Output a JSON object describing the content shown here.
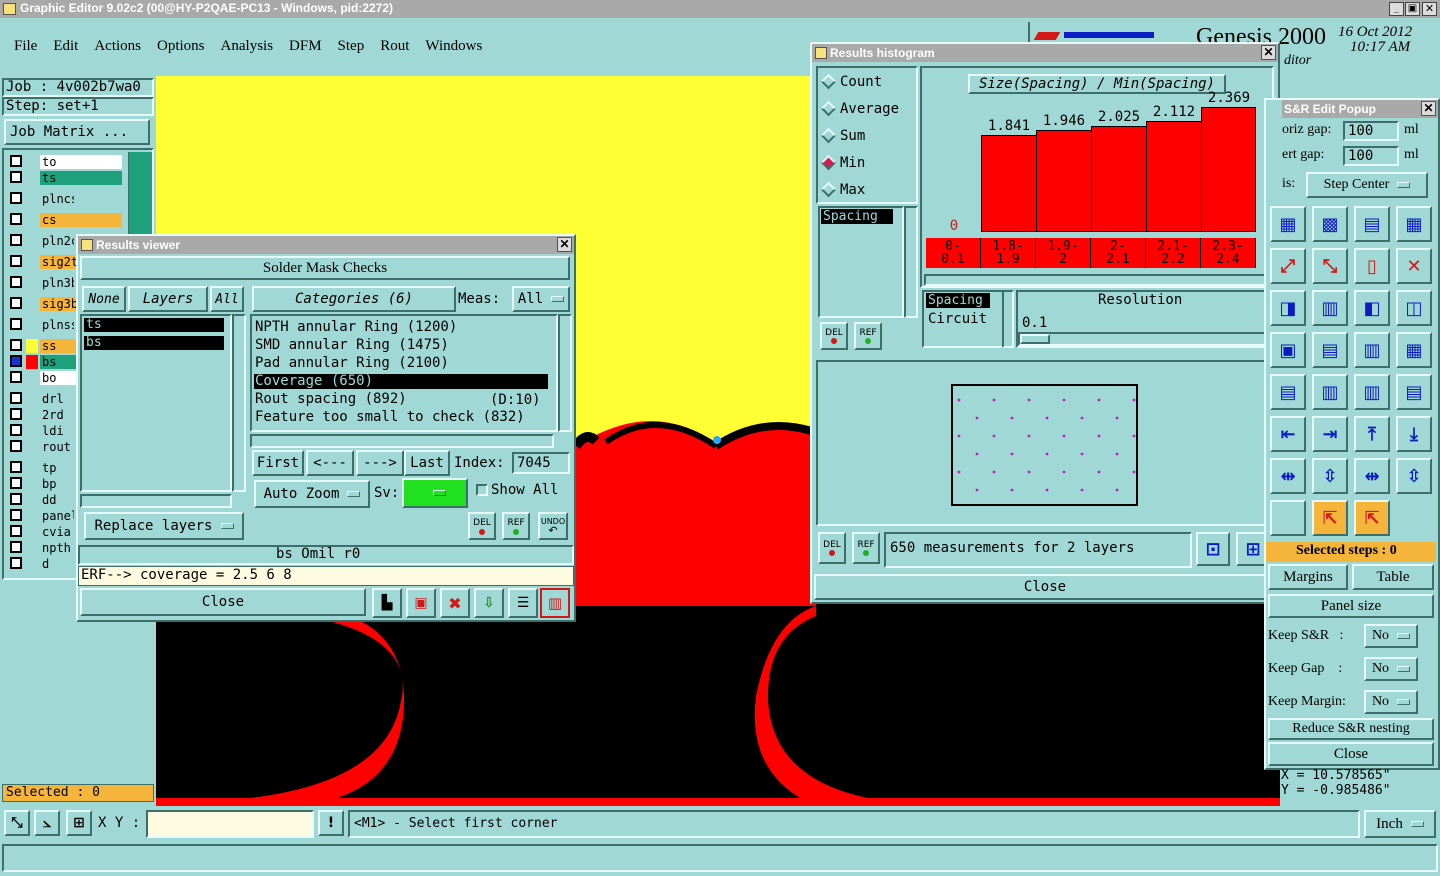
{
  "window_title": "Graphic Editor 9.02c2 (00@HY-P2QAE-PC13 - Windows, pid:2272)",
  "menu": [
    "File",
    "Edit",
    "Actions",
    "Options",
    "Analysis",
    "DFM",
    "Step",
    "Rout",
    "Windows"
  ],
  "app": {
    "product": "Genesis 2000",
    "date": "16 Oct 2012",
    "time": "10:17 AM",
    "sub": "ditor"
  },
  "left": {
    "job": "Job : 4v002b7wa0",
    "step": "Step: set+1",
    "job_matrix": "Job Matrix ...",
    "selected": "Selected : 0",
    "layers": [
      {
        "name": "to",
        "bg": "#ffffff"
      },
      {
        "name": "ts",
        "bg": "#1fa07c"
      },
      {
        "name": "plncs",
        "bg": "#9fd8d4"
      },
      {
        "name": "cs",
        "bg": "#f5b53b"
      },
      {
        "name": "pln2c",
        "bg": "#9fd8d4"
      },
      {
        "name": "sig2t",
        "bg": "#f5b53b"
      },
      {
        "name": "pln3b",
        "bg": "#9fd8d4"
      },
      {
        "name": "sig3b",
        "bg": "#f5b53b"
      },
      {
        "name": "plnss",
        "bg": "#9fd8d4"
      },
      {
        "name": "ss",
        "bg": "#f5b53b"
      },
      {
        "name": "bs",
        "bg": "#1fa07c"
      },
      {
        "name": "bo",
        "bg": "#ffffff"
      },
      {
        "name": "drl",
        "bg": "#9fd8d4"
      },
      {
        "name": "2rd",
        "bg": "#9fd8d4"
      },
      {
        "name": "ldi",
        "bg": "#9fd8d4"
      },
      {
        "name": "rout",
        "bg": "#9fd8d4"
      },
      {
        "name": "tp",
        "bg": "#9fd8d4"
      },
      {
        "name": "bp",
        "bg": "#9fd8d4"
      },
      {
        "name": "dd",
        "bg": "#9fd8d4"
      },
      {
        "name": "panel",
        "bg": "#9fd8d4"
      },
      {
        "name": "cvia",
        "bg": "#9fd8d4"
      },
      {
        "name": "npth",
        "bg": "#9fd8d4"
      },
      {
        "name": "d",
        "bg": "#9fd8d4"
      }
    ]
  },
  "results_viewer": {
    "title": "Results viewer",
    "heading": "Solder Mask Checks",
    "none": "None",
    "layers": "Layers",
    "all": "All",
    "categories": "Categories (6)",
    "meas_label": "Meas:",
    "meas_value": "All",
    "layer_list": [
      "ts",
      "bs"
    ],
    "category_list": [
      "NPTH annular Ring (1200)",
      "SMD annular Ring (1475)",
      "Pad annular Ring (2100)",
      "Coverage (650)",
      "Rout spacing (892)",
      "Feature too small to check (832)"
    ],
    "rout_extra": "(D:10)",
    "first": "First",
    "prev": "<---",
    "next": "--->",
    "last": "Last",
    "index_label": "Index:",
    "index_value": "7045",
    "auto_zoom": "Auto Zoom",
    "sv": "Sv:",
    "show_all": "Show All",
    "replace_layers": "Replace layers",
    "del": "DEL",
    "ref": "REF",
    "undo": "UNDO",
    "status": "bs Omil  r0",
    "erf": "ERF--> coverage = 2.5 6 8",
    "close": "Close"
  },
  "histogram": {
    "title": "Results histogram",
    "modes": [
      "Count",
      "Average",
      "Sum",
      "Min",
      "Max"
    ],
    "selected_mode": "Min",
    "list": [
      "Spacing"
    ],
    "list2": [
      "Spacing",
      "Circuit"
    ],
    "resolution_label": "Resolution",
    "resolution_value": "0.1",
    "del": "DEL",
    "ref": "REF",
    "summary": "650 measurements for 2 layers",
    "close": "Close"
  },
  "chart_data": {
    "type": "bar",
    "title": "Size(Spacing) / Min(Spacing)",
    "categories": [
      "0-\n0.1",
      "1.8-\n1.9",
      "1.9-\n2",
      "2-\n2.1",
      "2.1-\n2.2",
      "2.3-\n2.4"
    ],
    "values": [
      0,
      1.841,
      1.946,
      2.025,
      2.112,
      2.369
    ],
    "value_labels": [
      "0",
      "1.841",
      "1.946",
      "2.025",
      "2.112",
      "2.369"
    ],
    "ylim": [
      0,
      2.6
    ]
  },
  "sr_popup": {
    "title": "S&R Edit Popup",
    "horiz_label": "oriz gap:",
    "horiz_value": "100",
    "vert_label": "ert  gap:",
    "vert_value": "100",
    "unit": "ml",
    "axis_label": "is:",
    "axis_value": "Step Center",
    "selected_steps": "Selected steps : 0",
    "margins": "Margins",
    "table": "Table",
    "panel_size": "Panel size",
    "keep_sr": "Keep S&R   :",
    "keep_gap": "Keep Gap    :",
    "keep_margin": "Keep Margin:",
    "no": "No",
    "reduce": "Reduce S&R nesting",
    "close": "Close"
  },
  "coords": {
    "x": "X = 10.578565\"",
    "y": "Y = -0.985486\""
  },
  "bottom": {
    "xy_label": "X Y :",
    "message": "<M1> - Select first corner",
    "units": "Inch"
  },
  "colors": {
    "canvas_yellow": "#ffff33",
    "canvas_red": "#ff0000",
    "canvas_black": "#000000",
    "panel": "#9fd8d4",
    "highlight": "#000000"
  }
}
